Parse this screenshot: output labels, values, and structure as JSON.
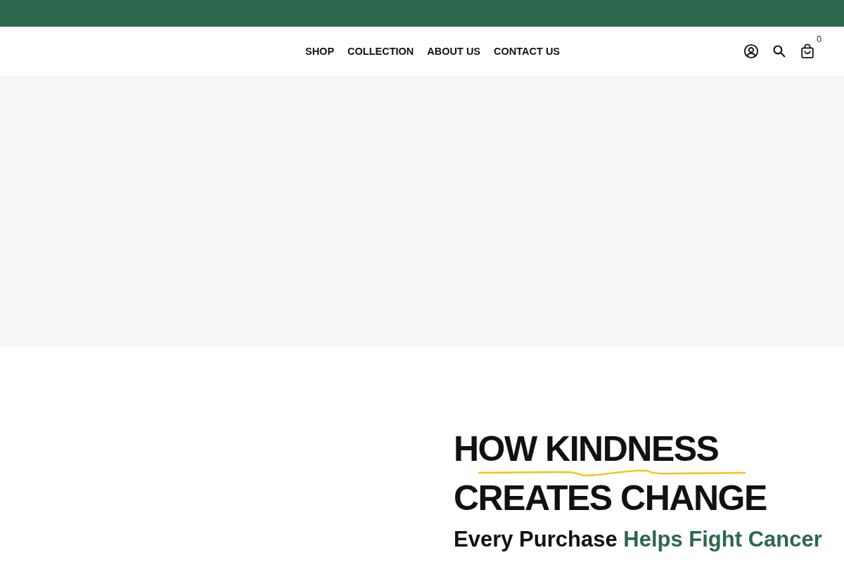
{
  "nav": {
    "links": [
      "SHOP",
      "COLLECTION",
      "ABOUT US",
      "CONTACT US"
    ],
    "cart_count": "0"
  },
  "feature": {
    "title_lines": [
      "HOW KINDNESS",
      "CREATES CHANGE"
    ],
    "subtitle": {
      "lead": "Every Purchase",
      "highlight": "Helps Fight Cancer"
    }
  }
}
